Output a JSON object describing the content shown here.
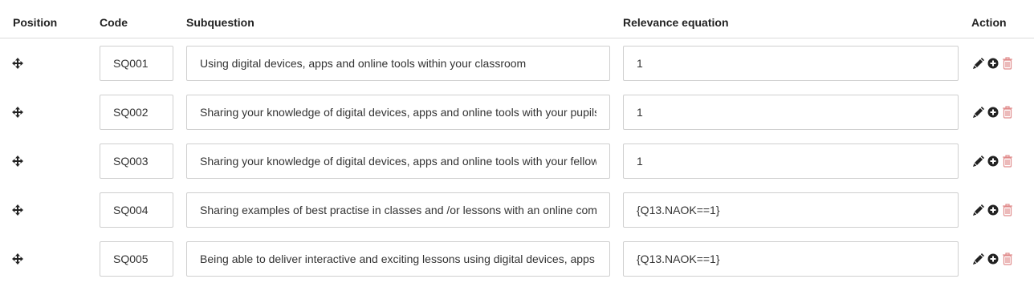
{
  "header": {
    "position": "Position",
    "code": "Code",
    "subquestion": "Subquestion",
    "relevance": "Relevance equation",
    "action": "Action"
  },
  "icons": {
    "move": "move-arrows-icon",
    "edit": "pencil-icon",
    "add": "plus-circle-icon",
    "delete": "trash-icon"
  },
  "colors": {
    "icon": "#222222",
    "delete_icon": "#e08b8b",
    "border": "#cfcfcf"
  },
  "rows": [
    {
      "code": "SQ001",
      "subquestion": "Using digital devices, apps and online tools within your classroom",
      "relevance": "1"
    },
    {
      "code": "SQ002",
      "subquestion": "Sharing your knowledge of digital devices, apps and online tools with your pupils",
      "relevance": "1"
    },
    {
      "code": "SQ003",
      "subquestion": "Sharing your knowledge of digital devices, apps and online tools with your fellow",
      "relevance": "1"
    },
    {
      "code": "SQ004",
      "subquestion": "Sharing examples of best practise in classes and /or lessons with an online com",
      "relevance": "{Q13.NAOK==1}"
    },
    {
      "code": "SQ005",
      "subquestion": "Being able to deliver interactive and exciting lessons using digital devices, apps",
      "relevance": "{Q13.NAOK==1}"
    }
  ]
}
